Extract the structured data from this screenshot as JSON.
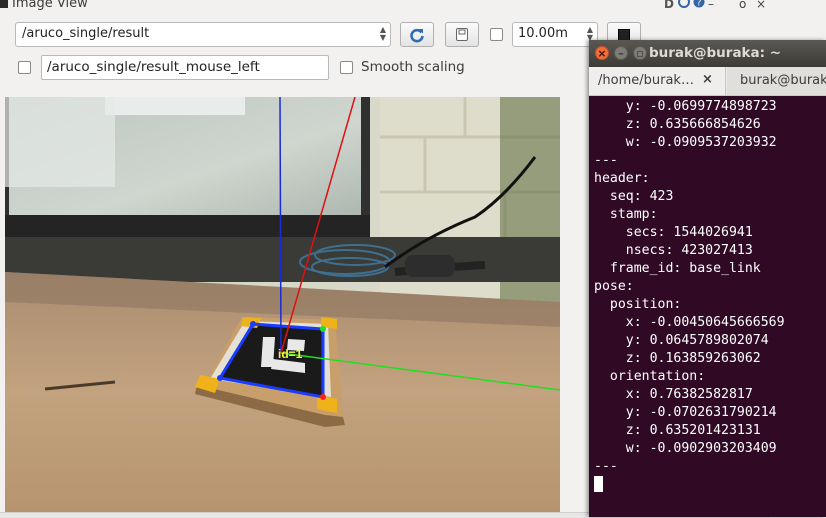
{
  "rqt": {
    "title": "Image View",
    "title_controls": {
      "minimize": "–",
      "close": "×",
      "float": "o",
      "help": "?"
    },
    "topic_combo": {
      "value": "/aruco_single/result"
    },
    "refresh_icon": "refresh-icon",
    "save_icon": "save-icon",
    "timeout": {
      "checked": false,
      "value": "10.00m"
    },
    "stop_icon": "stop-icon",
    "mouse_topic": {
      "checked": false,
      "value": "/aruco_single/result_mouse_left"
    },
    "smooth_scaling": {
      "checked": false,
      "label": "Smooth scaling"
    },
    "marker_label": "id=1"
  },
  "terminal": {
    "title": "burak@buraka: ~",
    "tabs": [
      {
        "label": "/home/burak…",
        "close": "×"
      },
      {
        "label": "burak@burak"
      }
    ],
    "lines": [
      "    y: -0.0699774898723",
      "    z: 0.635666854626",
      "    w: -0.0909537203932",
      "---",
      "header:",
      "  seq: 423",
      "  stamp:",
      "    secs: 1544026941",
      "    nsecs: 423027413",
      "  frame_id: base_link",
      "pose:",
      "  position:",
      "    x: -0.00450645666569",
      "    y: 0.0645789802074",
      "    z: 0.163859263062",
      "  orientation:",
      "    x: 0.76382582817",
      "    y: -0.0702631790214",
      "    z: 0.635201423131",
      "    w: -0.0902903203409",
      "---"
    ]
  }
}
